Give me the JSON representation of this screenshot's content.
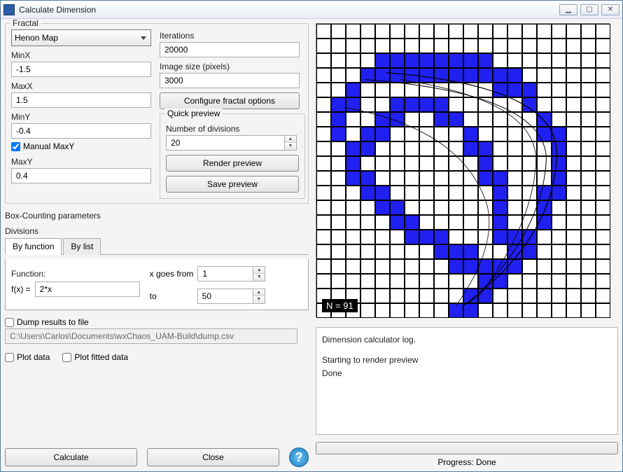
{
  "window": {
    "title": "Calculate Dimension"
  },
  "fractal": {
    "legend": "Fractal",
    "type_selected": "Henon Map",
    "minx_label": "MinX",
    "minx": "-1.5",
    "maxx_label": "MaxX",
    "maxx": "1.5",
    "miny_label": "MinY",
    "miny": "-0.4",
    "manual_maxy_label": "Manual MaxY",
    "manual_maxy_checked": true,
    "maxy_label": "MaxY",
    "maxy": "0.4",
    "iterations_label": "Iterations",
    "iterations": "20000",
    "imgsize_label": "Image size (pixels)",
    "imgsize": "3000",
    "config_btn": "Configure fractal options"
  },
  "quick": {
    "legend": "Quick preview",
    "divisions_label": "Number of divisions",
    "divisions": "20",
    "render_btn": "Render preview",
    "save_btn": "Save preview"
  },
  "boxcount": {
    "legend": "Box-Counting parameters",
    "divisions_label": "Divisions",
    "tab_func": "By function",
    "tab_list": "By list",
    "function_label": "Function:",
    "fx_prefix": "f(x)  =",
    "fx_value": "2*x",
    "xfrom_label": "x goes from",
    "xfrom": "1",
    "xto_label": "to",
    "xto": "50"
  },
  "dump": {
    "dump_label": "Dump results to file",
    "dump_checked": false,
    "path": "C:\\Users\\Carlos\\Documents\\wxChaos_UAM-Build\\dump.csv",
    "plot_data_label": "Plot data",
    "plot_data_checked": false,
    "plot_fitted_label": "Plot fitted data",
    "plot_fitted_checked": false
  },
  "buttons": {
    "calculate": "Calculate",
    "close": "Close"
  },
  "preview": {
    "n_badge": "N = 91",
    "grid_divisions": 20,
    "filled_cells": [
      [
        2,
        4
      ],
      [
        2,
        5
      ],
      [
        2,
        6
      ],
      [
        2,
        7
      ],
      [
        2,
        8
      ],
      [
        2,
        9
      ],
      [
        2,
        10
      ],
      [
        2,
        11
      ],
      [
        3,
        3
      ],
      [
        3,
        4
      ],
      [
        3,
        5
      ],
      [
        3,
        6
      ],
      [
        3,
        7
      ],
      [
        3,
        8
      ],
      [
        3,
        9
      ],
      [
        3,
        10
      ],
      [
        3,
        11
      ],
      [
        3,
        12
      ],
      [
        3,
        13
      ],
      [
        4,
        2
      ],
      [
        4,
        12
      ],
      [
        4,
        13
      ],
      [
        4,
        14
      ],
      [
        5,
        1
      ],
      [
        5,
        2
      ],
      [
        5,
        5
      ],
      [
        5,
        6
      ],
      [
        5,
        7
      ],
      [
        5,
        8
      ],
      [
        5,
        14
      ],
      [
        6,
        1
      ],
      [
        6,
        4
      ],
      [
        6,
        5
      ],
      [
        6,
        8
      ],
      [
        6,
        9
      ],
      [
        6,
        15
      ],
      [
        7,
        1
      ],
      [
        7,
        3
      ],
      [
        7,
        4
      ],
      [
        7,
        10
      ],
      [
        7,
        15
      ],
      [
        7,
        16
      ],
      [
        8,
        2
      ],
      [
        8,
        3
      ],
      [
        8,
        10
      ],
      [
        8,
        11
      ],
      [
        8,
        16
      ],
      [
        9,
        2
      ],
      [
        9,
        11
      ],
      [
        9,
        16
      ],
      [
        10,
        2
      ],
      [
        10,
        3
      ],
      [
        10,
        11
      ],
      [
        10,
        12
      ],
      [
        10,
        16
      ],
      [
        11,
        3
      ],
      [
        11,
        4
      ],
      [
        11,
        12
      ],
      [
        11,
        15
      ],
      [
        11,
        16
      ],
      [
        12,
        4
      ],
      [
        12,
        5
      ],
      [
        12,
        12
      ],
      [
        12,
        15
      ],
      [
        13,
        5
      ],
      [
        13,
        6
      ],
      [
        13,
        12
      ],
      [
        13,
        15
      ],
      [
        14,
        6
      ],
      [
        14,
        7
      ],
      [
        14,
        8
      ],
      [
        14,
        12
      ],
      [
        14,
        13
      ],
      [
        14,
        14
      ],
      [
        15,
        8
      ],
      [
        15,
        9
      ],
      [
        15,
        10
      ],
      [
        15,
        13
      ],
      [
        15,
        14
      ],
      [
        16,
        9
      ],
      [
        16,
        10
      ],
      [
        16,
        11
      ],
      [
        16,
        12
      ],
      [
        16,
        13
      ],
      [
        17,
        11
      ],
      [
        17,
        12
      ],
      [
        18,
        10
      ],
      [
        18,
        11
      ],
      [
        19,
        9
      ],
      [
        19,
        10
      ]
    ]
  },
  "log": {
    "header": "Dimension calculator log.",
    "lines": [
      "Starting to render preview",
      "Done"
    ]
  },
  "progress": {
    "text": "Progress: Done"
  }
}
